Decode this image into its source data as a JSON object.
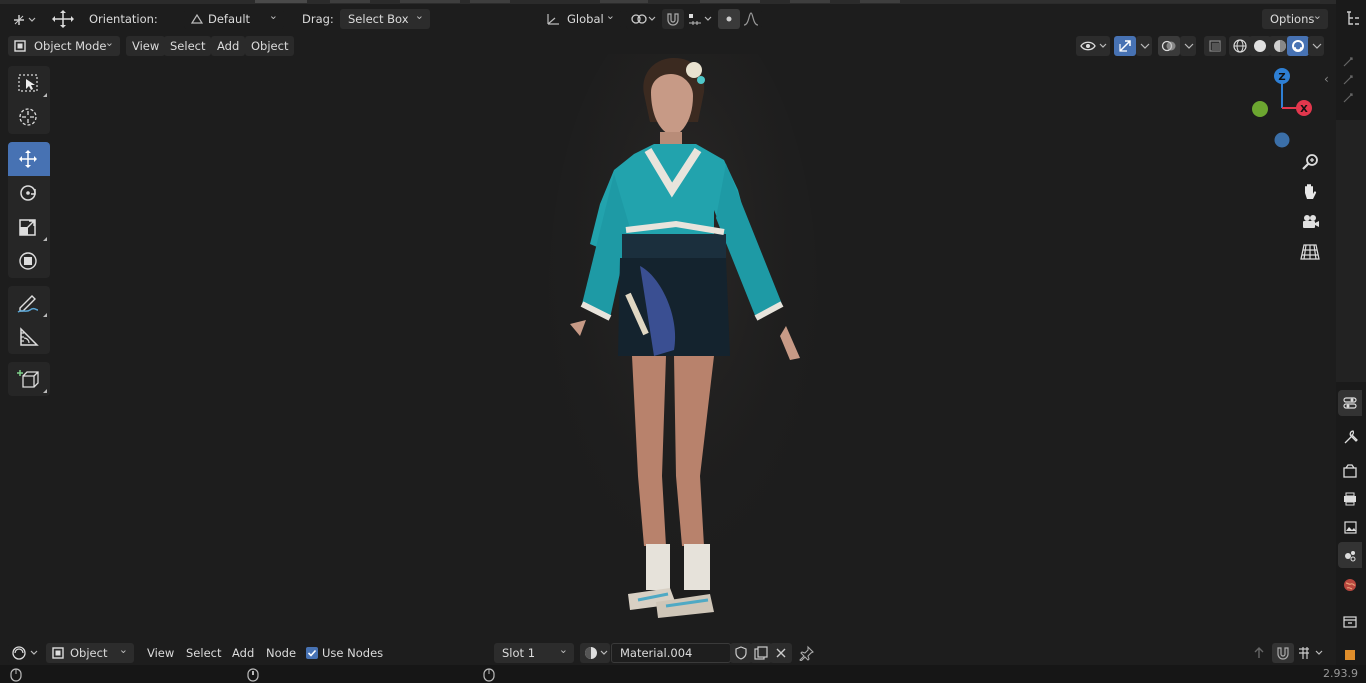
{
  "header": {
    "orientation_label": "Orientation:",
    "orientation_value": "Default",
    "drag_label": "Drag:",
    "drag_value": "Select Box",
    "transform_space": "Global",
    "options_label": "Options"
  },
  "viewport_header": {
    "mode": "Object Mode",
    "menus": [
      "View",
      "Select",
      "Add",
      "Object"
    ]
  },
  "gizmo": {
    "z_label": "Z",
    "x_label": "X",
    "colors": {
      "x": "#e2374d",
      "y": "#6ca630",
      "z": "#2e7fd4",
      "neg_z": "#3b6fa8"
    }
  },
  "node_editor_header": {
    "context": "Object",
    "menus": [
      "View",
      "Select",
      "Add",
      "Node"
    ],
    "use_nodes_label": "Use Nodes",
    "use_nodes_checked": true,
    "slot": "Slot 1",
    "material": "Material.004"
  },
  "status_bar": {
    "version": "2.93.9"
  },
  "theme": {
    "accent": "#4772b3",
    "background": "#1d1d1d"
  }
}
